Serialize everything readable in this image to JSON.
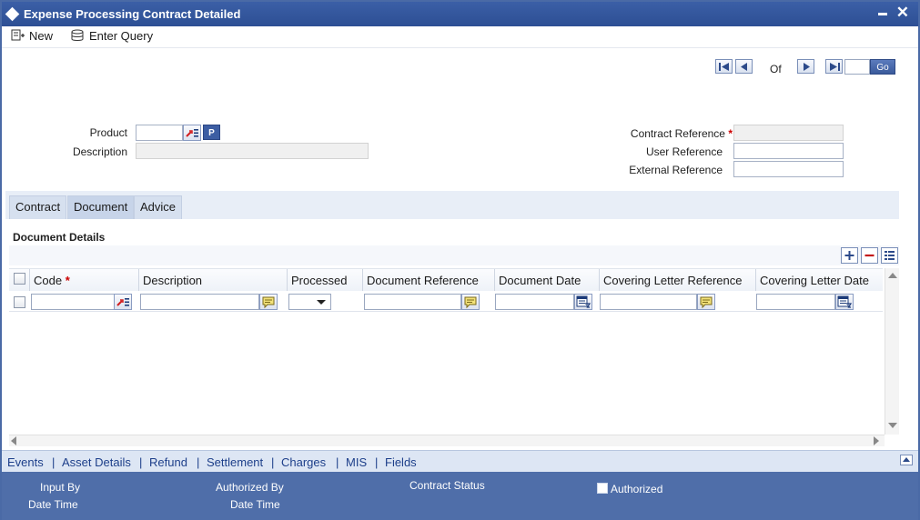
{
  "window": {
    "title": "Expense Processing Contract Detailed"
  },
  "toolbar": {
    "new_label": "New",
    "enter_query_label": "Enter Query"
  },
  "pagination": {
    "of_label": "Of",
    "go_label": "Go"
  },
  "form": {
    "product_label": "Product",
    "product_p_button": "P",
    "description_label": "Description",
    "contract_reference_label": "Contract Reference",
    "required_mark": "*",
    "user_reference_label": "User Reference",
    "external_reference_label": "External Reference"
  },
  "tabs": [
    {
      "label": "Contract"
    },
    {
      "label": "Document"
    },
    {
      "label": "Advice"
    }
  ],
  "document_details": {
    "title": "Document Details",
    "columns": [
      {
        "label": "Code"
      },
      {
        "label": "Description"
      },
      {
        "label": "Processed"
      },
      {
        "label": "Document Reference"
      },
      {
        "label": "Document Date"
      },
      {
        "label": "Covering Letter Reference"
      },
      {
        "label": "Covering Letter Date"
      }
    ]
  },
  "linkbar": {
    "items": [
      "Events",
      "Asset Details",
      "Refund",
      "Settlement",
      "Charges",
      "MIS",
      "Fields"
    ],
    "separator": "|"
  },
  "footer": {
    "input_by_label": "Input By",
    "date_time_label": "Date Time",
    "authorized_by_label": "Authorized By",
    "date_time_label_2": "Date Time",
    "contract_status_label": "Contract Status",
    "authorized_label": "Authorized"
  },
  "colors": {
    "title_bar": "#2d4f94",
    "footer": "#4f6ea9",
    "link": "#1d3f8a"
  }
}
